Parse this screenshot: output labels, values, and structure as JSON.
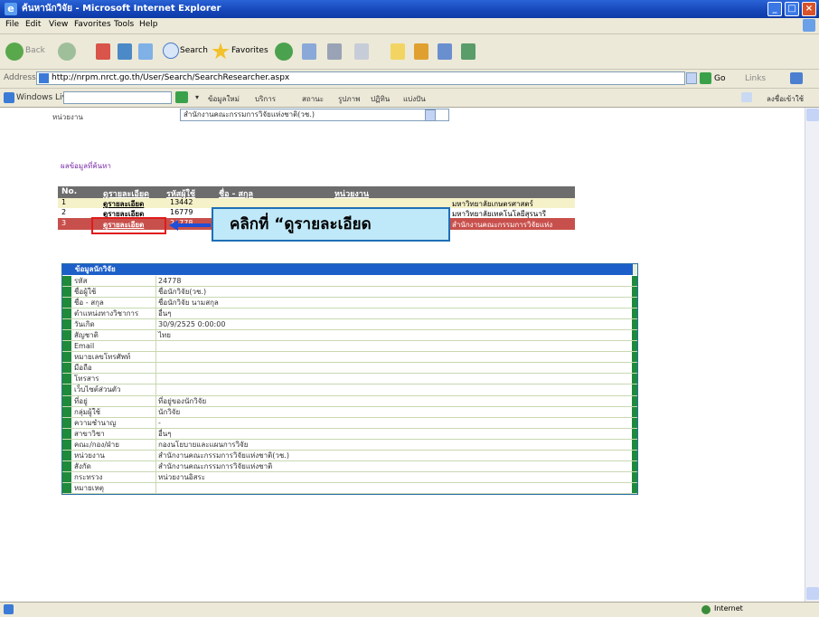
{
  "window": {
    "title": "ค้นหานักวิจัย - Microsoft Internet Explorer"
  },
  "menu": [
    "File",
    "Edit",
    "View",
    "Favorites",
    "Tools",
    "Help"
  ],
  "toolbar": {
    "back_label": "Back",
    "search_label": "Search",
    "favorites_label": "Favorites"
  },
  "address": {
    "label": "Address",
    "url": "http://nrpm.nrct.go.th/User/Search/SearchResearcher.aspx",
    "go_label": "Go",
    "links_label": "Links"
  },
  "windows_live": {
    "label": "Windows Live",
    "items": [
      "ข้อมูลใหม่",
      "บริการ",
      "สถานะ",
      "รูปภาพ",
      "ปฏิทิน",
      "แบ่งปัน"
    ],
    "right_label": "ลงชื่อเข้าใช้"
  },
  "page": {
    "agency_label": "หน่วยงาน",
    "agency_value": "สำนักงานคณะกรรมการวิจัยแห่งชาติ(วช.)",
    "result_label": "ผลข้อมูลที่ค้นหา",
    "results_headers": [
      "No.",
      "ดูรายละเอียด",
      "รหัสผู้ใช้",
      "ชื่อ - สกุล",
      "หน่วยงาน"
    ],
    "results": [
      {
        "no": "1",
        "link": "ดูรายละเอียด",
        "code": "13442",
        "name": "",
        "agency": "มหาวิทยาลัยเกษตรศาสตร์"
      },
      {
        "no": "2",
        "link": "ดูรายละเอียด",
        "code": "16779",
        "name": "",
        "agency": "มหาวิทยาลัยเทคโนโลยีสุรนารี"
      },
      {
        "no": "3",
        "link": "ดูรายละเอียด",
        "code": "24778",
        "name": "",
        "agency": "สำนักงานคณะกรรมการวิจัยแห่งชาติ(วช.)"
      }
    ],
    "callout": "คลิกที่ “ดูรายละเอียด",
    "detail_title": "ข้อมูลนักวิจัย",
    "detail_rows": [
      {
        "label": "รหัส",
        "value": "24778"
      },
      {
        "label": "ชื่อผู้ใช้",
        "value": "ชื่อนักวิจัย(วช.)"
      },
      {
        "label": "ชื่อ - สกุล",
        "value": "ชื่อนักวิจัย นามสกุล"
      },
      {
        "label": "ตำแหน่งทางวิชาการ",
        "value": "อื่นๆ"
      },
      {
        "label": "วันเกิด",
        "value": "30/9/2525 0:00:00"
      },
      {
        "label": "สัญชาติ",
        "value": "ไทย"
      },
      {
        "label": "Email",
        "value": ""
      },
      {
        "label": "หมายเลขโทรศัพท์",
        "value": ""
      },
      {
        "label": "มือถือ",
        "value": ""
      },
      {
        "label": "โทรสาร",
        "value": ""
      },
      {
        "label": "เว็บไซต์ส่วนตัว",
        "value": ""
      },
      {
        "label": "ที่อยู่",
        "value": "ที่อยู่ของนักวิจัย"
      },
      {
        "label": "กลุ่มผู้ใช้",
        "value": "นักวิจัย"
      },
      {
        "label": "ความชำนาญ",
        "value": "-"
      },
      {
        "label": "สาขาวิชา",
        "value": "อื่นๆ"
      },
      {
        "label": "คณะ/กอง/ฝ่าย",
        "value": "กองนโยบายและแผนการวิจัย"
      },
      {
        "label": "หน่วยงาน",
        "value": "สำนักงานคณะกรรมการวิจัยแห่งชาติ(วช.)"
      },
      {
        "label": "สังกัด",
        "value": "สำนักงานคณะกรรมการวิจัยแห่งชาติ"
      },
      {
        "label": "กระทรวง",
        "value": "หน่วยงานอิสระ"
      },
      {
        "label": "หมายเหตุ",
        "value": ""
      }
    ]
  },
  "status": {
    "zone": "Internet"
  }
}
